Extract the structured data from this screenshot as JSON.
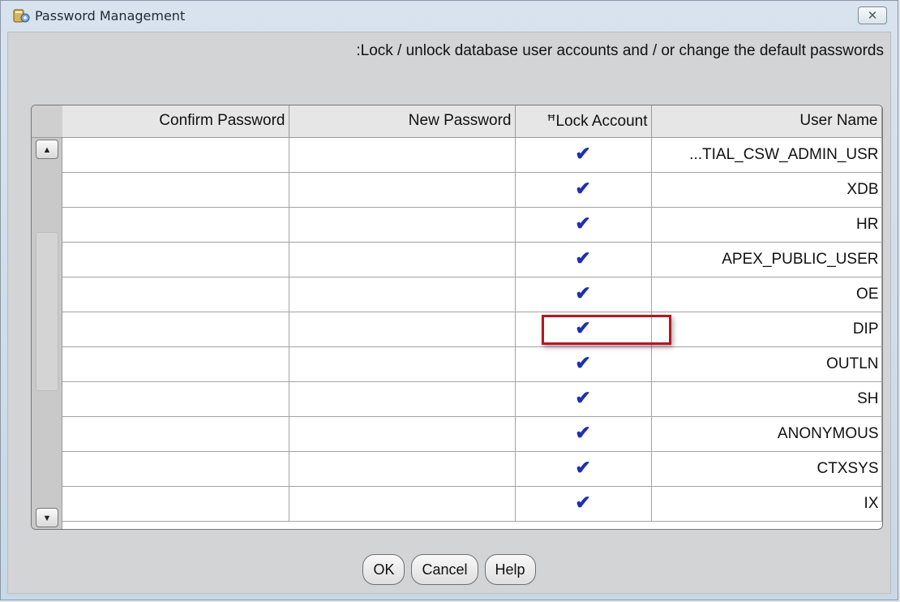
{
  "window": {
    "title": "Password Management",
    "close_symbol": "✕"
  },
  "instruction": ":Lock / unlock database user accounts and / or change the default passwords",
  "table": {
    "columns": [
      "Confirm Password",
      "New Password",
      "ꟸLock Account",
      "User Name"
    ],
    "rows": [
      {
        "confirm_password": "",
        "new_password": "",
        "lock_account": "✔",
        "user_name": "...TIAL_CSW_ADMIN_USR"
      },
      {
        "confirm_password": "",
        "new_password": "",
        "lock_account": "✔",
        "user_name": "XDB"
      },
      {
        "confirm_password": "",
        "new_password": "",
        "lock_account": "✔",
        "user_name": "HR"
      },
      {
        "confirm_password": "",
        "new_password": "",
        "lock_account": "✔",
        "user_name": "APEX_PUBLIC_USER"
      },
      {
        "confirm_password": "",
        "new_password": "",
        "lock_account": "✔",
        "user_name": "OE"
      },
      {
        "confirm_password": "",
        "new_password": "",
        "lock_account": "✔",
        "user_name": "DIP"
      },
      {
        "confirm_password": "",
        "new_password": "",
        "lock_account": "✔",
        "user_name": "OUTLN"
      },
      {
        "confirm_password": "",
        "new_password": "",
        "lock_account": "✔",
        "user_name": "SH"
      },
      {
        "confirm_password": "",
        "new_password": "",
        "lock_account": "✔",
        "user_name": "ANONYMOUS"
      },
      {
        "confirm_password": "",
        "new_password": "",
        "lock_account": "✔",
        "user_name": "CTXSYS"
      },
      {
        "confirm_password": "",
        "new_password": "",
        "lock_account": "✔",
        "user_name": "IX"
      }
    ]
  },
  "buttons": {
    "ok": "OK",
    "cancel": "Cancel",
    "help": "Help"
  },
  "icons": {
    "app": "settings-app-icon",
    "close": "close-icon",
    "scroll_up": "scroll-up-arrow-icon",
    "scroll_down": "scroll-down-arrow-icon",
    "check": "checkmark-icon"
  },
  "colors": {
    "highlight_border": "#b01a22",
    "checkmark": "#1f2fb0"
  }
}
